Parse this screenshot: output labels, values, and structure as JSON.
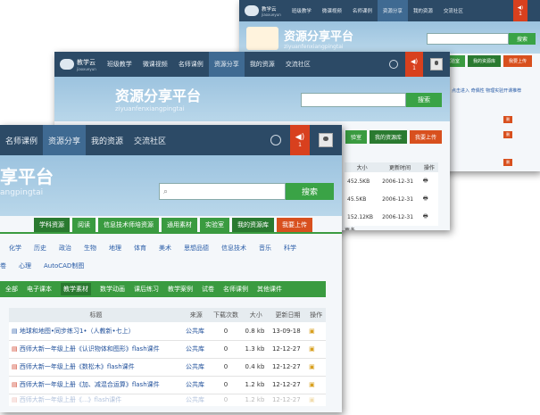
{
  "back_window": {
    "logo": "教学云",
    "logo_sub": "jiaoxueyun",
    "nav": [
      "班级教学",
      "微课视频",
      "名师课例",
      "资源分享",
      "我的资源",
      "交流社区"
    ],
    "badge": "1",
    "mini_tabs": [
      "试验室",
      "我的资源库",
      "我要上传"
    ],
    "line_text": "点击进入   奇偶性   物理实验开课推荐",
    "small_buttons": [
      "删",
      "删",
      "删"
    ]
  },
  "middle_window": {
    "logo": "教学云",
    "logo_sub": "jiaoxueyun",
    "nav": [
      "班级教学",
      "微课视频",
      "名师课例",
      "资源分享",
      "我的资源",
      "交流社区"
    ],
    "badge": "1",
    "brand_title": "资源分享平台",
    "brand_pinyin": "ziyuanfenxiangpingtai",
    "search_button": "搜索",
    "right_tabs": [
      "验室",
      "我的资源库",
      "我要上传"
    ],
    "table_headers": [
      "大小",
      "更新时间",
      "操作"
    ],
    "rows": [
      {
        "size": "452.5KB",
        "date": "2006-12-31"
      },
      {
        "size": "45.5KB",
        "date": "2006-12-31"
      },
      {
        "size": "152.12KB",
        "date": "2006-12-31"
      }
    ],
    "extra": "更多"
  },
  "front_window": {
    "nav": [
      "名师课例",
      "资源分享",
      "我的资源",
      "交流社区"
    ],
    "badge": "1",
    "brand_title": "享平台",
    "brand_pinyin": "angpingtai",
    "search_button": "搜索",
    "top_tabs": [
      "学科资源",
      "阅读",
      "信息技术师培资源",
      "通用素材",
      "实验室",
      "我的资源库",
      "我要上传"
    ],
    "subjects_row1": [
      "化学",
      "历史",
      "政治",
      "生物",
      "地理",
      "体育",
      "美术",
      "思想品德",
      "信息技术",
      "音乐",
      "科学"
    ],
    "subjects_row2": [
      "卷",
      "心理",
      "AutoCAD制图"
    ],
    "filter_tabs": [
      "全部",
      "电子课本",
      "教学素材",
      "数学动画",
      "课后练习",
      "教学案例",
      "试卷",
      "名师课例",
      "其他课件"
    ],
    "table_headers": [
      "标题",
      "来源",
      "下载次数",
      "大小",
      "更新日期",
      "操作"
    ],
    "rows": [
      {
        "title": "地球和地图•同步练习1•（人教新•七上）",
        "source": "公共库",
        "downloads": "0",
        "size": "0.8 kb",
        "date": "13-09-18"
      },
      {
        "title": "西师大新一年级上册《认识物体和图形》flash课件",
        "source": "公共库",
        "downloads": "0",
        "size": "1.3 kb",
        "date": "12-12-27"
      },
      {
        "title": "西师大新一年级上册《数松木》flash课件",
        "source": "公共库",
        "downloads": "0",
        "size": "0.4 kb",
        "date": "12-12-27"
      },
      {
        "title": "西师大新一年级上册《加、减混合运算》flash课件",
        "source": "公共库",
        "downloads": "0",
        "size": "1.2 kb",
        "date": "12-12-27"
      },
      {
        "title": "西师大新一年级上册《...》flash课件",
        "source": "公共库",
        "downloads": "0",
        "size": "1.2 kb",
        "date": "12-12-27"
      }
    ]
  },
  "colors": {
    "nav_bg": "#2c4a66",
    "banner": "#a9cde6",
    "green": "#3aa346",
    "orange": "#d8401e"
  }
}
